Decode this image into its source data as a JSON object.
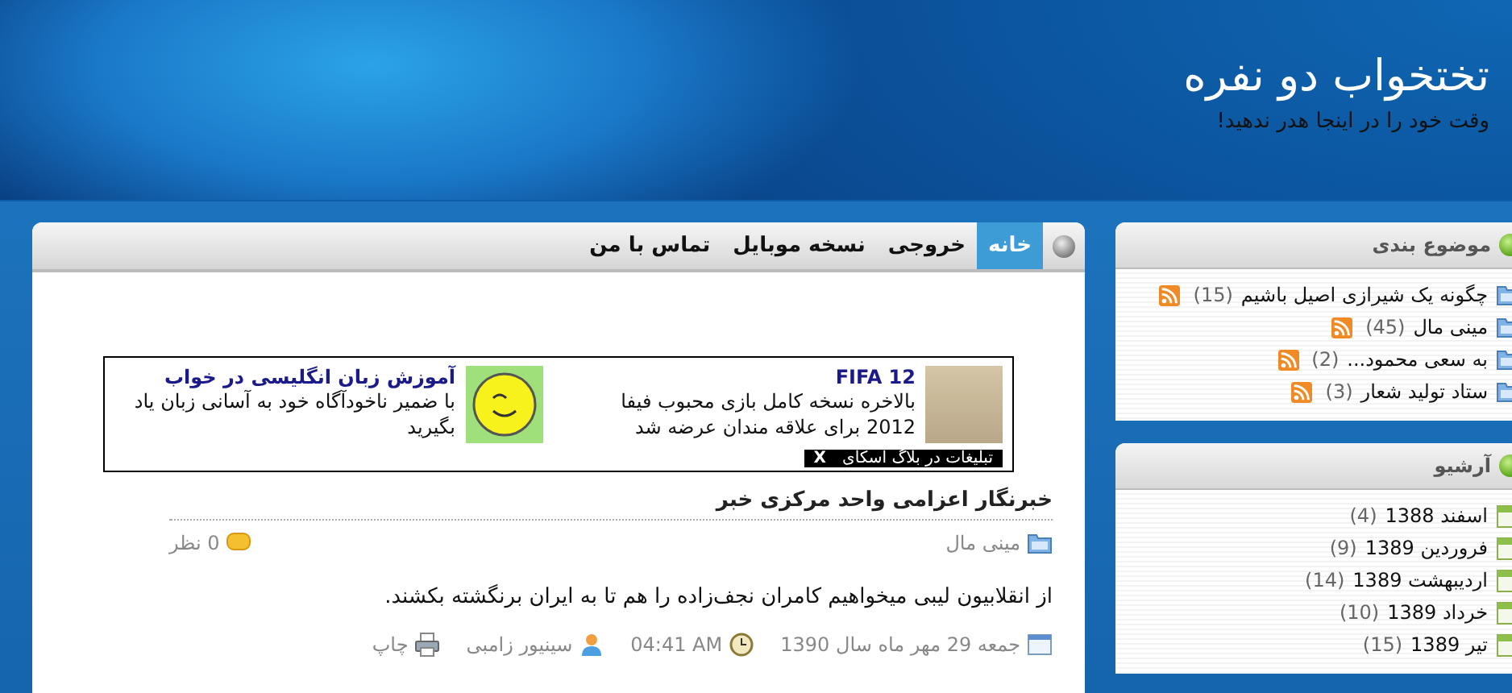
{
  "header": {
    "title": "تختخواب دو نفره",
    "tagline": "وقت خود را در اینجا هدر ندهید!"
  },
  "menu": [
    {
      "label": "خانه",
      "selected": true
    },
    {
      "label": "خروجی",
      "selected": false
    },
    {
      "label": "نسخه موبایل",
      "selected": false
    },
    {
      "label": "تماس با من",
      "selected": false
    }
  ],
  "ad": {
    "items": [
      {
        "kind": "game",
        "title": "FIFA 12",
        "text": "بالاخره نسخه کامل بازی محبوب فیفا 2012 برای علاقه مندان عرضه شد"
      },
      {
        "kind": "smiley",
        "title": "آموزش زبان انگلیسی در خواب",
        "text": "با ضمیر ناخودآگاه خود به آسانی زبان یاد بگیرید"
      }
    ],
    "footer": "تبلیغات در بلاگ اسکای",
    "close": "X"
  },
  "post": {
    "title": "خبرنگار اعزامی واحد مرکزی خبر",
    "category": "مینی مال",
    "comments": "0 نظر",
    "body": "از انقلابیون لیبی میخواهیم کامران نجف‌زاده را هم تا به ایران برنگشته بکشند.",
    "date": "جمعه 29 مهر ماه سال 1390",
    "time": "04:41 AM",
    "author": "سینیور زامبی",
    "print": "چاپ"
  },
  "sidebar": [
    {
      "kind": "categories",
      "title": "موضوع بندی",
      "items": [
        {
          "label": "چگونه یک شیرازی اصیل باشیم",
          "count": "(15)"
        },
        {
          "label": "مینی مال",
          "count": "(45)"
        },
        {
          "label": "به سعی محمود...",
          "count": "(2)"
        },
        {
          "label": "ستاد تولید شعار",
          "count": "(3)"
        }
      ]
    },
    {
      "kind": "archive",
      "title": "آرشیو",
      "items": [
        {
          "label": "اسفند 1388",
          "count": "(4)"
        },
        {
          "label": "فروردین 1389",
          "count": "(9)"
        },
        {
          "label": "اردیبهشت 1389",
          "count": "(14)"
        },
        {
          "label": "خرداد 1389",
          "count": "(10)"
        },
        {
          "label": "تیر 1389",
          "count": "(15)"
        }
      ]
    }
  ]
}
